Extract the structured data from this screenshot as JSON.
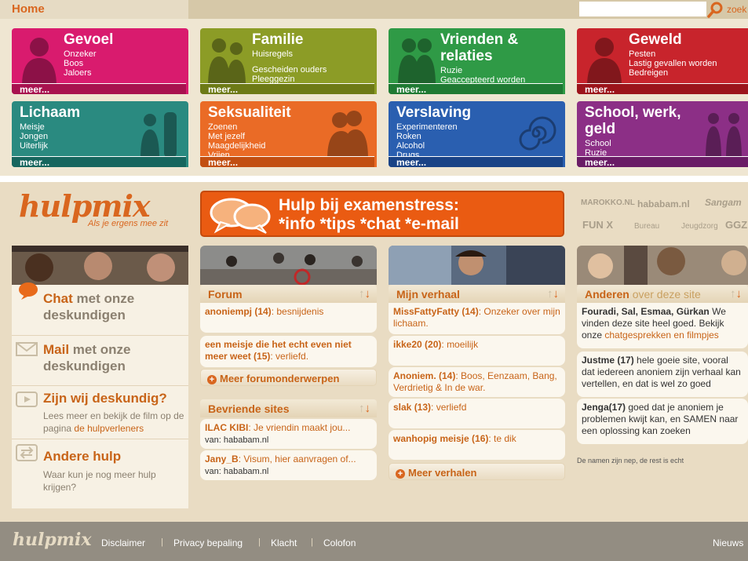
{
  "top": {
    "home": "Home",
    "search_label": "zoek",
    "search_placeholder": ""
  },
  "tiles": [
    {
      "title": "Gevoel",
      "items": [
        "Onzeker",
        "Boos",
        "Jaloers"
      ],
      "more": "meer...",
      "color": "#d91b6e",
      "dark": "#a8124f"
    },
    {
      "title": "Familie",
      "items": [
        "Huisregels",
        "",
        "Gescheiden ouders",
        "Pleeggezin"
      ],
      "more": "meer...",
      "color": "#8c9c26",
      "dark": "#6d7a16"
    },
    {
      "title": "Vrienden & relaties",
      "items": [
        "Ruzie",
        "Geaccepteerd worden"
      ],
      "more": "meer...",
      "color": "#2f9a46",
      "dark": "#1f7a33"
    },
    {
      "title": "Geweld",
      "items": [
        "Pesten",
        "Lastig gevallen worden",
        "Bedreigen"
      ],
      "more": "meer...",
      "color": "#c8242c",
      "dark": "#9c141b"
    },
    {
      "title": "Lichaam",
      "items": [
        "Meisje",
        "Jongen",
        "Uiterlijk"
      ],
      "more": "meer...",
      "color": "#2a8a80",
      "dark": "#17665e"
    },
    {
      "title": "Seksualiteit",
      "items": [
        "Zoenen",
        "Met jezelf",
        "Maagdelijkheid",
        "Vrijen"
      ],
      "more": "meer...",
      "color": "#ea6b26",
      "dark": "#c24f12"
    },
    {
      "title": "Verslaving",
      "items": [
        "Experimenteren",
        "Roken",
        "Alcohol",
        "Drugs"
      ],
      "more": "meer...",
      "color": "#2a5fb0",
      "dark": "#1a4386"
    },
    {
      "title": "School, werk, geld",
      "items": [
        "School",
        "Ruzie"
      ],
      "more": "meer...",
      "color": "#8c2f86",
      "dark": "#6a1c66"
    }
  ],
  "logo": {
    "name": "hulpmix",
    "tagline": "Als je ergens mee zit"
  },
  "banner": {
    "line1": "Hulp bij examenstress:",
    "line2": "*info *tips *chat *e-mail"
  },
  "partners": [
    "MAROKKO.NL",
    "hababam.nl",
    "Sangam",
    "FUN X",
    "Bureau",
    "Jeugdzorg",
    "GGZ"
  ],
  "left": {
    "chat": {
      "a": "Chat",
      "b": "met onze deskundigen"
    },
    "mail": {
      "a": "Mail",
      "b": "met onze deskundigen"
    },
    "deskundig": {
      "h": "Zijn wij deskundig?",
      "d": "Lees meer en bekijk de film op de pagina",
      "link": "de hulpverleners"
    },
    "andere": {
      "h": "Andere hulp",
      "d": "Waar kun je nog meer hulp krijgen?"
    }
  },
  "forum": {
    "title": "Forum",
    "posts": [
      {
        "user": "anoniempj (14)",
        "text": "besnijdenis"
      },
      {
        "user": "een meisje die het echt even niet meer weet (15)",
        "text": "verliefd."
      }
    ],
    "more": "Meer forumonderwerpen"
  },
  "bevriende": {
    "title": "Bevriende sites",
    "posts": [
      {
        "user": "ILAC KIBI",
        "text": "Je vriendin maakt jou...",
        "via": "van: hababam.nl"
      },
      {
        "user": "Jany_B",
        "text": "Visum, hier aanvragen of...",
        "via": "van: hababam.nl"
      }
    ]
  },
  "verhaal": {
    "title": "Mijn verhaal",
    "posts": [
      {
        "user": "MissFattyFatty (14)",
        "text": "Onzeker over mijn lichaam."
      },
      {
        "user": "ikke20 (20)",
        "text": "moeilijk"
      },
      {
        "user": "Anoniem. (14)",
        "text": "Boos, Eenzaam, Bang, Verdrietig & In de war."
      },
      {
        "user": "slak (13)",
        "text": "verliefd"
      },
      {
        "user": "wanhopig meisje (16)",
        "text": "te dik"
      }
    ],
    "more": "Meer verhalen"
  },
  "anderen": {
    "title_a": "Anderen",
    "title_b": "over deze site",
    "q1": {
      "user": "Fouradi, Sal, Esmaa, Gürkan",
      "text": "We vinden deze site heel goed. Bekijk onze",
      "link": "chatgesprekken en filmpjes"
    },
    "q2": {
      "user": "Justme (17)",
      "text": "hele goeie site, vooral dat iedereen anoniem zijn verhaal kan vertellen, en dat is wel zo goed"
    },
    "q3": {
      "user": "Jenga(17)",
      "text": "goed dat je anoniem je problemen kwijt kan, en SAMEN naar een oplossing kan zoeken"
    },
    "note": "De namen zijn nep, de rest is echt"
  },
  "footer": {
    "logo": "hulpmix",
    "links": [
      "Disclaimer",
      "Privacy bepaling",
      "Klacht",
      "Colofon"
    ],
    "news": "Nieuws"
  }
}
